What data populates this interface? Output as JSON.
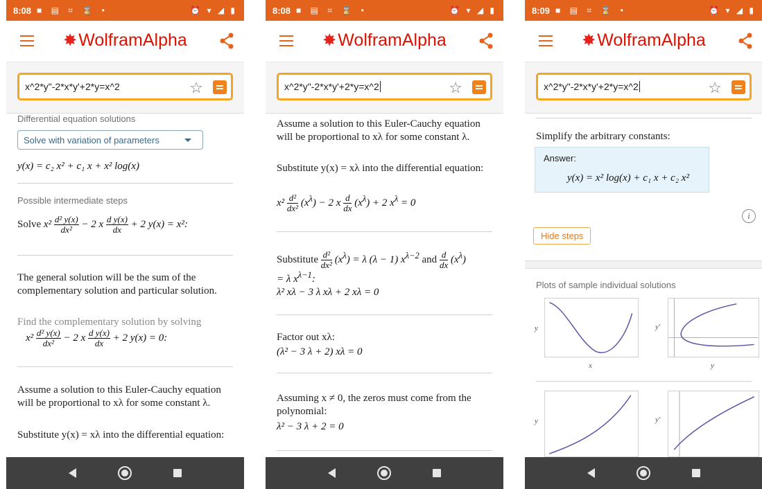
{
  "status": [
    {
      "time": "8:08"
    },
    {
      "time": "8:08"
    },
    {
      "time": "8:09"
    }
  ],
  "app": {
    "brand": "WolframAlpha"
  },
  "search": {
    "query": "x^2*y\"-2*x*y'+2*y=x^2"
  },
  "screen1": {
    "section_title": "Differential equation solutions",
    "method_select": "Solve with variation of parameters",
    "solution": "y(x) = c₂ x² + c₁ x + x² log(x)",
    "steps_title": "Possible intermediate steps",
    "solve_prefix": "Solve",
    "p1": "The general solution will be the sum of the complementary solution and particular solution.",
    "p2_grey": "Find the complementary solution by solving",
    "p3": "Assume a solution to this Euler-Cauchy equation will be proportional to xλ for some constant λ.",
    "p4": "Substitute y(x) = xλ into the differential equation:"
  },
  "screen2": {
    "p1": "Assume a solution to this Euler-Cauchy equation will be proportional to xλ for some constant λ.",
    "p2": "Substitute y(x) = xλ into the differential equation:",
    "p3_prefix": "Substitute",
    "p3_and": "and",
    "eq3": "λ² xλ − 3 λ xλ + 2 xλ = 0",
    "p4": "Factor out xλ:",
    "eq4": "(λ² − 3 λ + 2) xλ = 0",
    "p5": "Assuming x ≠ 0, the zeros must come from the polynomial:",
    "eq5": "λ² − 3 λ + 2 = 0"
  },
  "screen3": {
    "simplify": "Simplify the arbitrary constants:",
    "answer_label": "Answer:",
    "answer": "y(x) = x² log(x) + c₁ x + c₂ x²",
    "hide_steps": "Hide steps",
    "plots_title": "Plots of sample individual solutions",
    "axis_y": "y",
    "axis_yprime": "y′",
    "axis_x": "x"
  },
  "colors": {
    "status_bar": "#e3631d",
    "brand": "#dd1100",
    "search_border": "#f4a622",
    "nav_bar": "#404040"
  },
  "icons": [
    "menu-icon",
    "share-icon",
    "favorite-star-icon",
    "go-button-icon",
    "back-icon",
    "home-icon",
    "recents-icon",
    "info-icon"
  ]
}
